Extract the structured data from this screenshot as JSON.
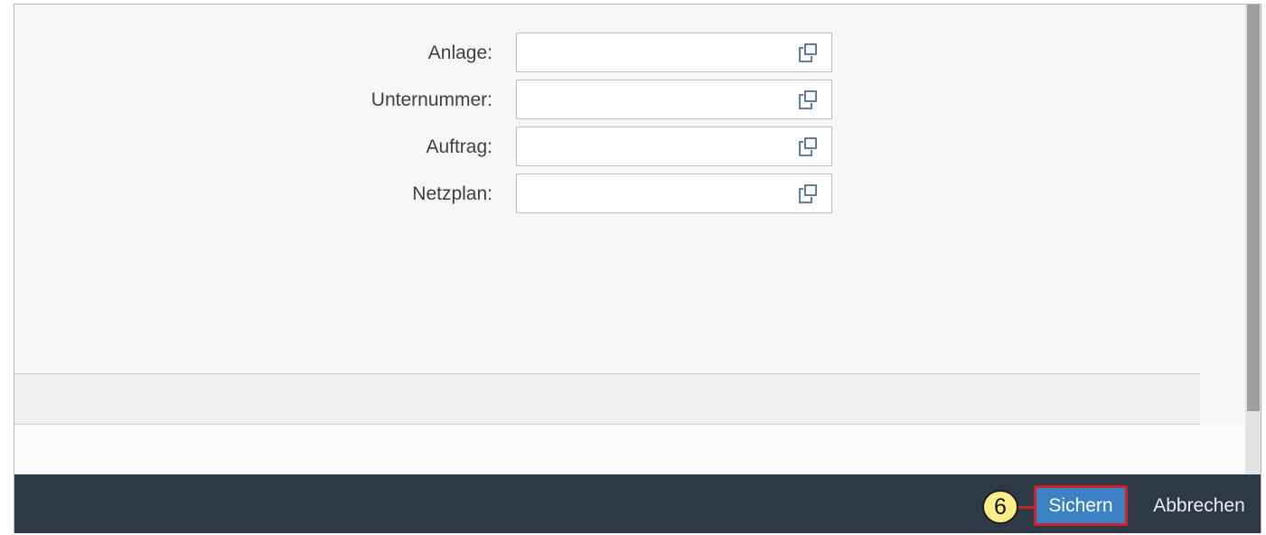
{
  "form": {
    "fields": [
      {
        "label": "Anlage:",
        "value": "",
        "icon": "value-help-icon"
      },
      {
        "label": "Unternummer:",
        "value": "",
        "icon": "value-help-icon"
      },
      {
        "label": "Auftrag:",
        "value": "",
        "icon": "value-help-icon"
      },
      {
        "label": "Netzplan:",
        "value": "",
        "icon": "value-help-icon"
      }
    ]
  },
  "footer": {
    "step_number": "6",
    "save_label": "Sichern",
    "cancel_label": "Abbrechen"
  },
  "colors": {
    "footer_bg": "#2d3a45",
    "primary_button": "#3b82c4",
    "highlight_border": "#d0202c",
    "badge_fill": "#ffee88"
  }
}
